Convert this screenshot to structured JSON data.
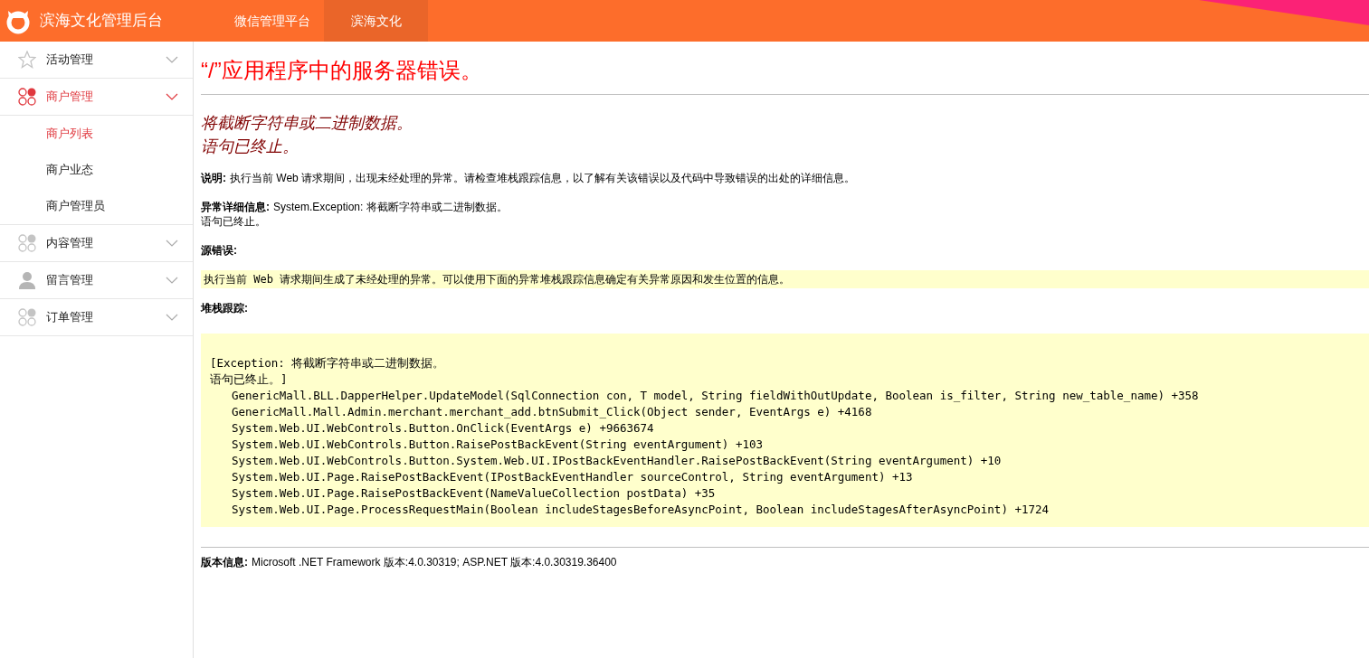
{
  "header": {
    "title": "滨海文化管理后台",
    "nav": [
      {
        "label": "微信管理平台",
        "selected": false
      },
      {
        "label": "滨海文化",
        "selected": true
      }
    ]
  },
  "sidebar": {
    "items": [
      {
        "label": "活动管理",
        "kind": "star",
        "selected": false
      },
      {
        "label": "商户管理",
        "kind": "grid",
        "selected": true,
        "children": [
          {
            "label": "商户列表",
            "selected": true
          },
          {
            "label": "商户业态",
            "selected": false
          },
          {
            "label": "商户管理员",
            "selected": false
          }
        ]
      },
      {
        "label": "内容管理",
        "kind": "grid",
        "selected": false
      },
      {
        "label": "留言管理",
        "kind": "person",
        "selected": false
      },
      {
        "label": "订单管理",
        "kind": "grid",
        "selected": false
      }
    ]
  },
  "error_page": {
    "title": "“/”应用程序中的服务器错误。",
    "message_lines": [
      "将截断字符串或二进制数据。",
      "语句已终止。"
    ],
    "description": {
      "label": "说明:",
      "text": "执行当前 Web 请求期间，出现未经处理的异常。请检查堆栈跟踪信息，以了解有关该错误以及代码中导致错误的出处的详细信息。"
    },
    "exception_details": {
      "label": "异常详细信息:",
      "lines": [
        "System.Exception: 将截断字符串或二进制数据。",
        "语句已终止。"
      ]
    },
    "source_error": {
      "label": "源错误:",
      "text": "执行当前 Web 请求期间生成了未经处理的异常。可以使用下面的异常堆栈跟踪信息确定有关异常原因和发生位置的信息。"
    },
    "stack_trace": {
      "label": "堆栈跟踪:",
      "header_lines": [
        "[Exception: 将截断字符串或二进制数据。",
        "语句已终止。]"
      ],
      "frames": [
        "GenericMall.BLL.DapperHelper.UpdateModel(SqlConnection con, T model, String fieldWithOutUpdate, Boolean is_filter, String new_table_name) +358",
        "GenericMall.Mall.Admin.merchant.merchant_add.btnSubmit_Click(Object sender, EventArgs e) +4168",
        "System.Web.UI.WebControls.Button.OnClick(EventArgs e) +9663674",
        "System.Web.UI.WebControls.Button.RaisePostBackEvent(String eventArgument) +103",
        "System.Web.UI.WebControls.Button.System.Web.UI.IPostBackEventHandler.RaisePostBackEvent(String eventArgument) +10",
        "System.Web.UI.Page.RaisePostBackEvent(IPostBackEventHandler sourceControl, String eventArgument) +13",
        "System.Web.UI.Page.RaisePostBackEvent(NameValueCollection postData) +35",
        "System.Web.UI.Page.ProcessRequestMain(Boolean includeStagesBeforeAsyncPoint, Boolean includeStagesAfterAsyncPoint) +1724"
      ]
    },
    "version": {
      "label": "版本信息:",
      "text": "Microsoft .NET Framework 版本:4.0.30319; ASP.NET 版本:4.0.30319.36400"
    }
  }
}
